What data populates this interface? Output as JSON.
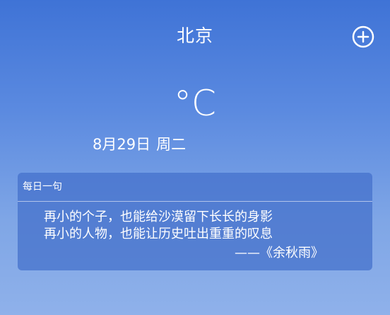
{
  "header": {
    "city": "北京",
    "add_icon": "plus-circle-icon"
  },
  "weather": {
    "temperature": "°C",
    "date": "8月29日",
    "weekday": "周二"
  },
  "daily_quote": {
    "title": "每日一句",
    "lines": [
      "再小的个子，也能给沙漠留下长长的身影",
      "再小的人物，也能让历史吐出重重的叹息"
    ],
    "author": "——《余秋雨》"
  }
}
